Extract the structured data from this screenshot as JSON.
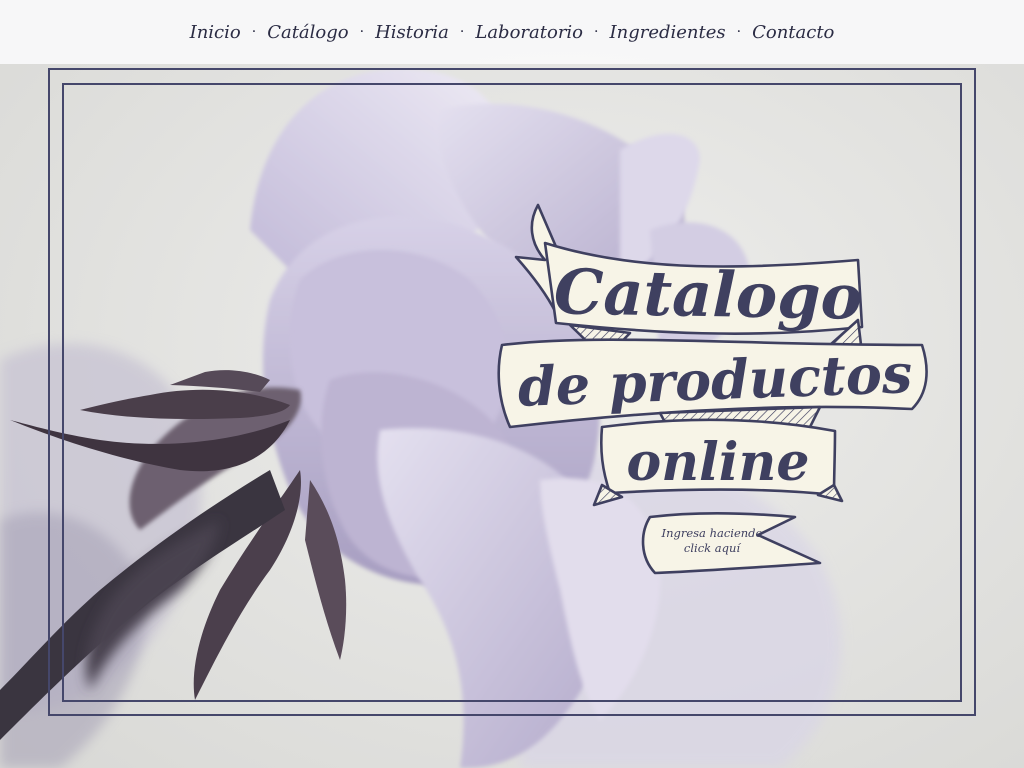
{
  "nav": {
    "items": [
      {
        "label": "Inicio"
      },
      {
        "label": "Catálogo"
      },
      {
        "label": "Historia"
      },
      {
        "label": "Laboratorio"
      },
      {
        "label": "Ingredientes"
      },
      {
        "label": "Contacto"
      }
    ],
    "separator": "·"
  },
  "banner": {
    "line1": "Catalogo",
    "line2": "de productos",
    "line3": "online"
  },
  "cta": {
    "line1": "Ingresa haciendo",
    "line2": "click aquí"
  },
  "colors": {
    "ink": "#3f4060",
    "frame": "#45476b",
    "ribbon_fill": "#f7f4e7",
    "petal": "#c9c3dc",
    "background": "#e6e6e3"
  }
}
